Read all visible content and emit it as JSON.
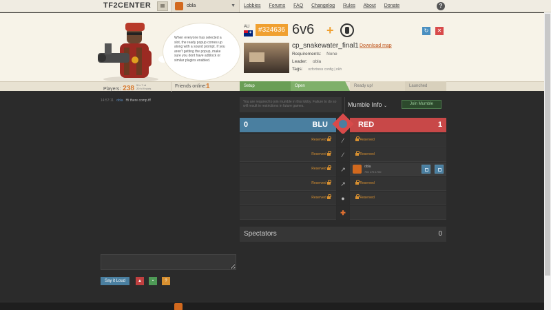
{
  "nav": {
    "logo": "TF2CENTER",
    "username": "obla",
    "links": [
      "Lobbies",
      "Forums",
      "FAQ",
      "Changelog",
      "Rules",
      "About",
      "Donate"
    ],
    "help": "?"
  },
  "bubble": {
    "text": "When everyone has selected a slot, the ready popup comes up along with a sound prompt. If you aren't getting the popup, make sure you dont have adblock or similar plugins enabled."
  },
  "lobby": {
    "region": "AU",
    "id": "#324636",
    "gametype": "6v6",
    "map": "cp_snakewater_final1",
    "download_map": "Download map",
    "requirements_label": "Requirements:",
    "requirements": "None",
    "leader_label": "Leader:",
    "leader": "obla",
    "tags_label": "Tags:",
    "tags": "ozfortress config | nkh"
  },
  "stats": {
    "players_label": "Players:",
    "players": "238",
    "players_sub1": "5 lv  7 rd",
    "players_sub2": "20 hl  9 slots",
    "friends_label": "Friends online:",
    "friends": "1"
  },
  "steps": [
    "Setup",
    "Open",
    "Ready up!",
    "Launched"
  ],
  "chat": {
    "time": "14:57:11",
    "user": "obla",
    "message": "Hi there comp.tf!",
    "say_button": "Say it Loud"
  },
  "mumble": {
    "note": "You are required to join mumble in this lobby. Failure to do so will result in restrictions in future games.",
    "info_label": "Mumble Info",
    "join_label": "Join Mumble"
  },
  "teams": {
    "blu": {
      "name": "BLU",
      "score": "0"
    },
    "red": {
      "name": "RED",
      "score": "1"
    },
    "reserved": "Reserved",
    "player": {
      "name": "obla",
      "stats": "750   175   1700"
    }
  },
  "spectators": {
    "label": "Spectators",
    "count": "0"
  },
  "colors": {
    "blu": "#4a7fa0",
    "red": "#c84848",
    "accent": "#f0a030",
    "setup": "#6a9e56"
  }
}
